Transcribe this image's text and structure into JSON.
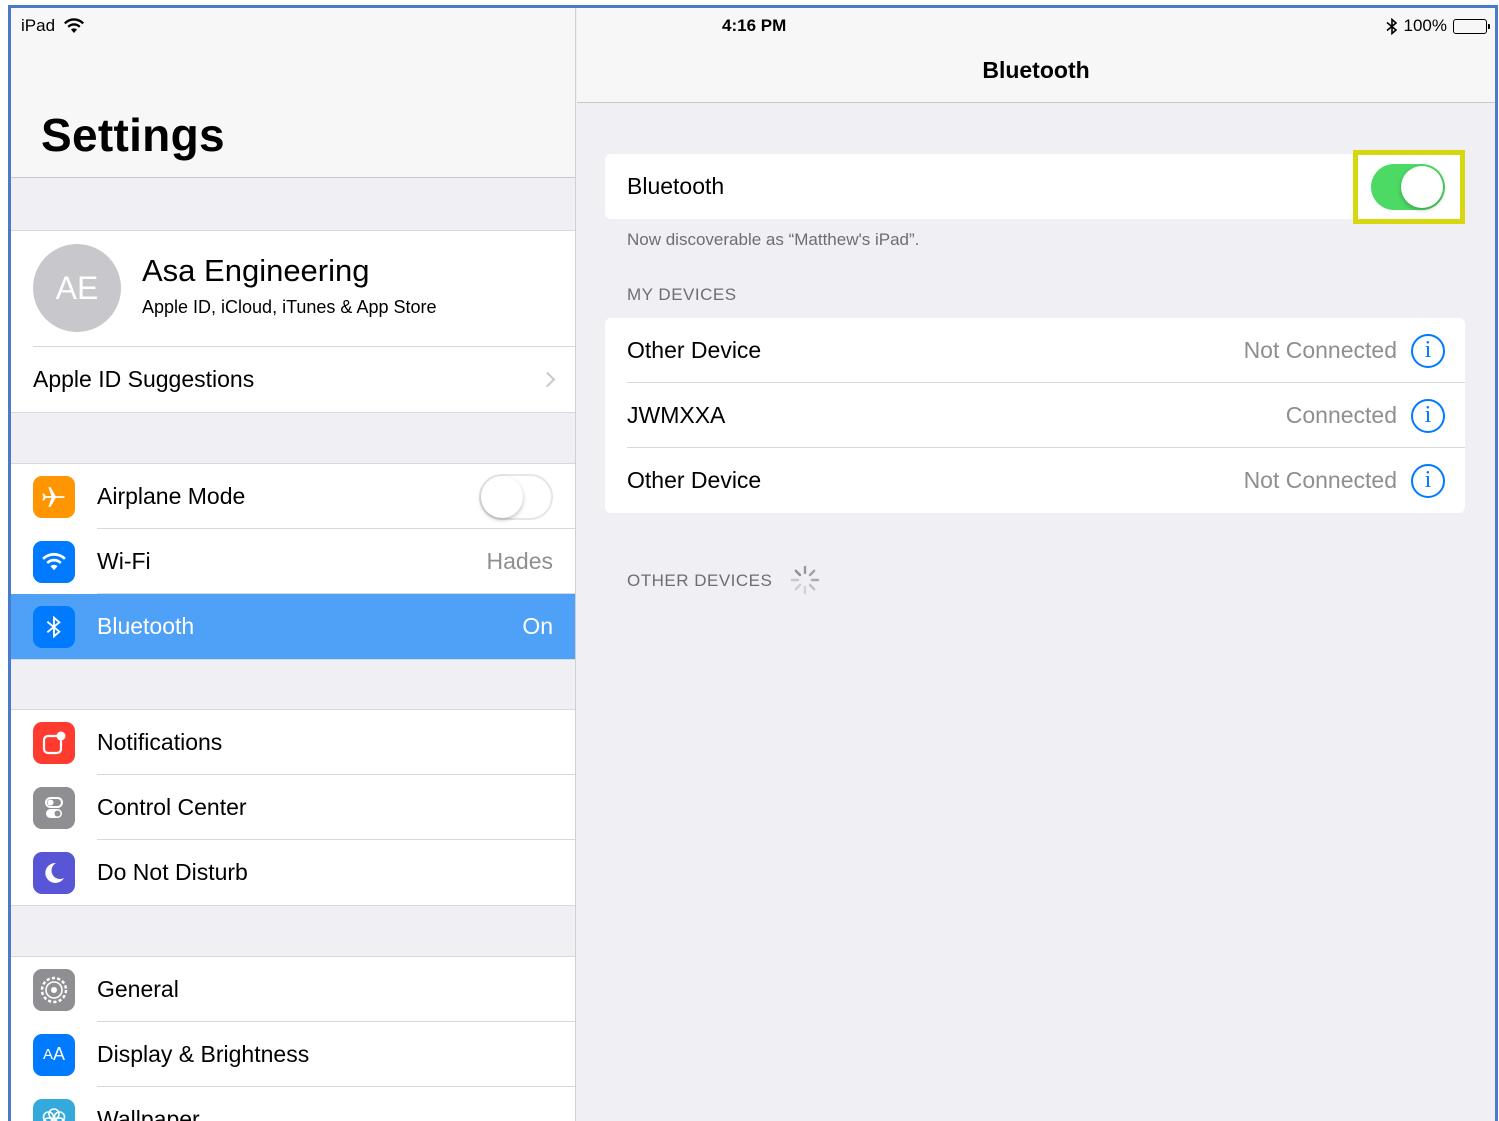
{
  "status_bar": {
    "device": "iPad",
    "time": "4:16 PM",
    "battery": "100%",
    "wifi_icon": "wifi-icon",
    "bluetooth_icon": "bluetooth-icon"
  },
  "master": {
    "title": "Settings",
    "profile": {
      "initials": "AE",
      "name": "Asa Engineering",
      "subtitle": "Apple ID, iCloud, iTunes & App Store"
    },
    "suggestions": {
      "label": "Apple ID Suggestions"
    },
    "connectivity": [
      {
        "label": "Airplane Mode",
        "icon": "airplane-icon",
        "color": "#ff9500",
        "toggle": false
      },
      {
        "label": "Wi-Fi",
        "icon": "wifi-icon",
        "color": "#007aff",
        "value": "Hades"
      },
      {
        "label": "Bluetooth",
        "icon": "bluetooth-icon",
        "color": "#007aff",
        "value": "On",
        "selected": true
      }
    ],
    "alerts": [
      {
        "label": "Notifications",
        "icon": "notifications-icon",
        "color": "#ff3b30"
      },
      {
        "label": "Control Center",
        "icon": "control-center-icon",
        "color": "#8e8e93"
      },
      {
        "label": "Do Not Disturb",
        "icon": "moon-icon",
        "color": "#5856d6"
      }
    ],
    "general": [
      {
        "label": "General",
        "icon": "gear-icon",
        "color": "#8e8e93"
      },
      {
        "label": "Display & Brightness",
        "icon": "display-icon",
        "color": "#007aff"
      },
      {
        "label": "Wallpaper",
        "icon": "wallpaper-icon",
        "color": "#34aadc"
      }
    ]
  },
  "detail": {
    "title": "Bluetooth",
    "bluetooth_label": "Bluetooth",
    "bluetooth_on": true,
    "discoverable_note": "Now discoverable as “Matthew's iPad”.",
    "my_devices_header": "MY DEVICES",
    "devices": [
      {
        "name": "Other Device",
        "status": "Not Connected"
      },
      {
        "name": "JWMXXA",
        "status": "Connected"
      },
      {
        "name": "Other Device",
        "status": "Not Connected"
      }
    ],
    "other_devices_header": "OTHER DEVICES",
    "info_glyph": "i",
    "highlight_color": "#d7d70f"
  }
}
